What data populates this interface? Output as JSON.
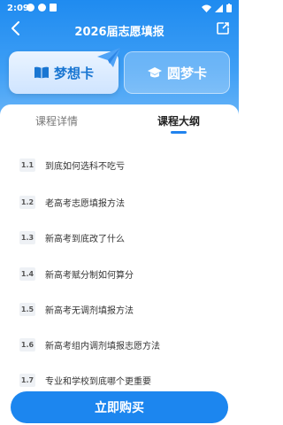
{
  "status": {
    "time": "2:09"
  },
  "header": {
    "title": "2026届志愿填报"
  },
  "cards": [
    {
      "label": "梦想卡"
    },
    {
      "label": "圆梦卡"
    }
  ],
  "tabs": [
    {
      "label": "课程详情"
    },
    {
      "label": "课程大纲"
    }
  ],
  "outline": [
    {
      "num": "1.1",
      "text": "到底如何选科不吃亏"
    },
    {
      "num": "1.2",
      "text": "老高考志愿填报方法"
    },
    {
      "num": "1.3",
      "text": "新高考到底改了什么"
    },
    {
      "num": "1.4",
      "text": "新高考赋分制如何算分"
    },
    {
      "num": "1.5",
      "text": "新高考无调剂填报方法"
    },
    {
      "num": "1.6",
      "text": "新高考组内调剂填报志愿方法"
    },
    {
      "num": "1.7",
      "text": "专业和学校到底哪个更重要"
    }
  ],
  "actions": {
    "buy": "立即购买"
  },
  "colors": {
    "primary": "#1c86ef",
    "accent": "#2183ee"
  }
}
